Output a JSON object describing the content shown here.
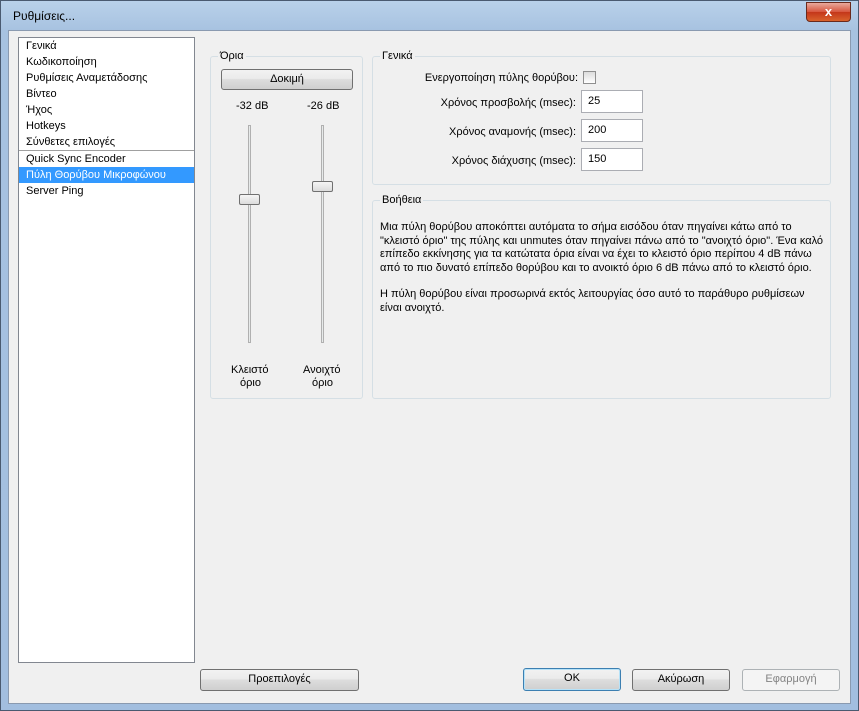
{
  "window": {
    "title": "Ρυθμίσεις...",
    "close_glyph": "x"
  },
  "categories": [
    {
      "label": "Γενικά"
    },
    {
      "label": "Κωδικοποίηση"
    },
    {
      "label": "Ρυθμίσεις Αναμετάδοσης"
    },
    {
      "label": "Βίντεο"
    },
    {
      "label": "Ήχος"
    },
    {
      "label": "Hotkeys"
    },
    {
      "label": "Σύνθετες επιλογές"
    },
    {
      "label": "Quick Sync Encoder"
    },
    {
      "label": "Πύλη Θορύβου Μικροφώνου",
      "selected": true
    },
    {
      "label": "Server Ping"
    }
  ],
  "limits": {
    "title": "Όρια",
    "test_button": "Δοκιμή",
    "closed_value": "-32 dB",
    "open_value": "-26 dB",
    "closed_label_1": "Κλειστό",
    "closed_label_2": "όριο",
    "open_label_1": "Ανοιχτό",
    "open_label_2": "όριο",
    "closed_level_fraction": 0.34,
    "open_level_fraction": 0.28
  },
  "general": {
    "title": "Γενικά",
    "enable_label": "Ενεργοποίηση πύλης θορύβου:",
    "enable_checked": false,
    "attack_label": "Χρόνος προσβολής (msec):",
    "attack_value": "25",
    "hold_label": "Χρόνος αναμονής (msec):",
    "hold_value": "200",
    "release_label": "Χρόνος διάχυσης (msec):",
    "release_value": "150"
  },
  "help": {
    "title": "Βοήθεια",
    "paragraph_1": "Μια πύλη θορύβου αποκόπτει αυτόματα το σήμα εισόδου όταν πηγαίνει κάτω από το \"κλειστό όριο\" της πύλης και unmutes όταν πηγαίνει πάνω από το \"ανοιχτό όριο\". Ένα καλό επίπεδο εκκίνησης για τα κατώτατα όρια είναι να έχει το κλειστό όριο περίπου 4 dB πάνω από το πιο δυνατό επίπεδο θορύβου και το ανοικτό όριο 6 dB πάνω από το κλειστό όριο.",
    "paragraph_2": "Η πύλη θορύβου είναι προσωρινά εκτός λειτουργίας όσο αυτό το παράθυρο ρυθμίσεων είναι ανοιχτό."
  },
  "buttons": {
    "defaults": "Προεπιλογές",
    "ok": "OK",
    "cancel": "Ακύρωση",
    "apply": "Εφαρμογή"
  }
}
